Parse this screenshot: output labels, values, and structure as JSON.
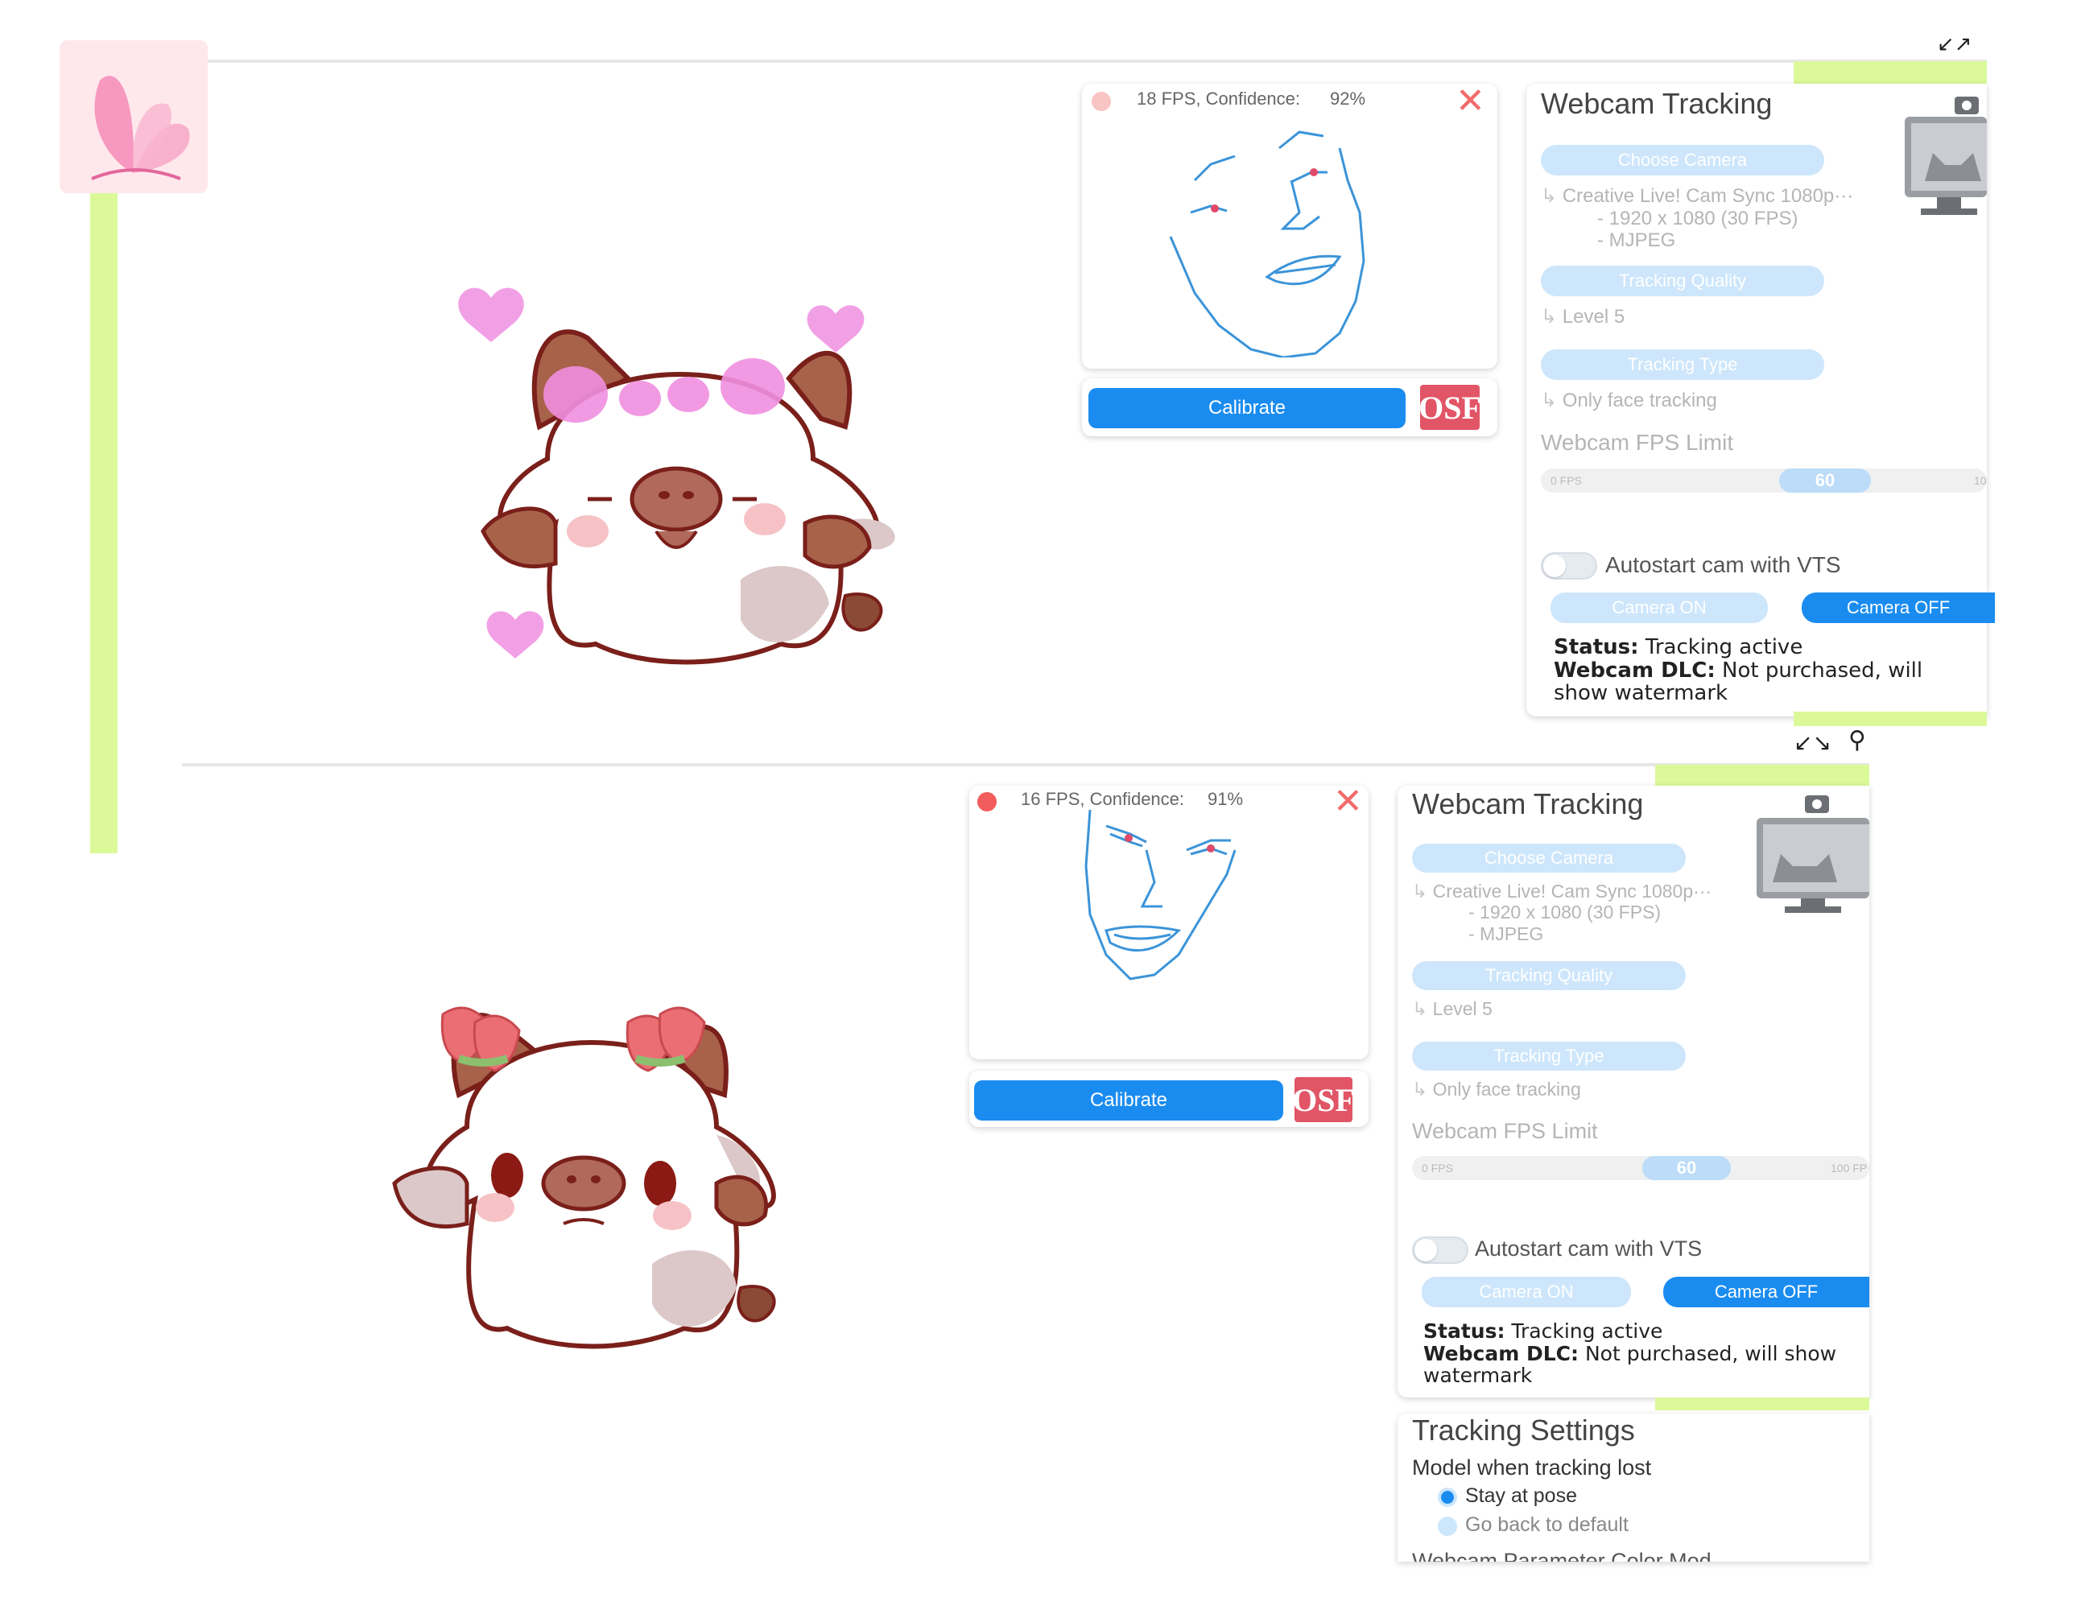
{
  "top_view": {
    "tracking_preview": {
      "fps_label": "18 FPS, Confidence:",
      "confidence": "92%",
      "dot_color": "#f9c4c4"
    },
    "calibrate_label": "Calibrate",
    "osf_label": "OSF",
    "webcam_panel": {
      "title": "Webcam Tracking",
      "choose_camera_label": "Choose Camera",
      "camera_name": "Creative Live! Cam Sync 1080p···",
      "resolution": "- 1920 x 1080 (30 FPS)",
      "format": "- MJPEG",
      "tracking_quality_label": "Tracking Quality",
      "tracking_quality_value": "Level 5",
      "tracking_type_label": "Tracking Type",
      "tracking_type_value": "Only face tracking",
      "fps_limit_label": "Webcam FPS Limit",
      "fps_min": "0 FPS",
      "fps_value": "60",
      "fps_max": "10",
      "autostart_label": "Autostart cam with VTS",
      "camera_on_label": "Camera ON",
      "camera_off_label": "Camera OFF",
      "status_key": "Status:",
      "status_value": "Tracking active",
      "dlc_key": "Webcam DLC:",
      "dlc_value": "Not purchased, will show watermark"
    }
  },
  "bottom_view": {
    "tracking_preview": {
      "fps_label": "16 FPS, Confidence:",
      "confidence": "91%",
      "dot_color": "#f25c5c"
    },
    "calibrate_label": "Calibrate",
    "osf_label": "OSF",
    "webcam_panel": {
      "title": "Webcam Tracking",
      "choose_camera_label": "Choose Camera",
      "camera_name": "Creative Live! Cam Sync 1080p···",
      "resolution": "- 1920 x 1080 (30 FPS)",
      "format": "- MJPEG",
      "tracking_quality_label": "Tracking Quality",
      "tracking_quality_value": "Level 5",
      "tracking_type_label": "Tracking Type",
      "tracking_type_value": "Only face tracking",
      "fps_limit_label": "Webcam FPS Limit",
      "fps_min": "0 FPS",
      "fps_value": "60",
      "fps_max": "100 FP",
      "autostart_label": "Autostart cam with VTS",
      "camera_on_label": "Camera ON",
      "camera_off_label": "Camera OFF",
      "status_key": "Status:",
      "status_value": "Tracking active",
      "dlc_key": "Webcam DLC:",
      "dlc_value": "Not purchased, will show watermark"
    },
    "tracking_settings": {
      "title": "Tracking Settings",
      "lost_label": "Model when tracking lost",
      "option_stay": "Stay at pose",
      "option_default": "Go back to default",
      "cut_off_text": "Webcam Parameter Color Mod"
    }
  },
  "colors": {
    "accent": "#1a8cf0",
    "green": "#dcf99a",
    "close": "#f26b6b",
    "face_line": "#3b94d9",
    "face_red": "#e04a6a"
  }
}
